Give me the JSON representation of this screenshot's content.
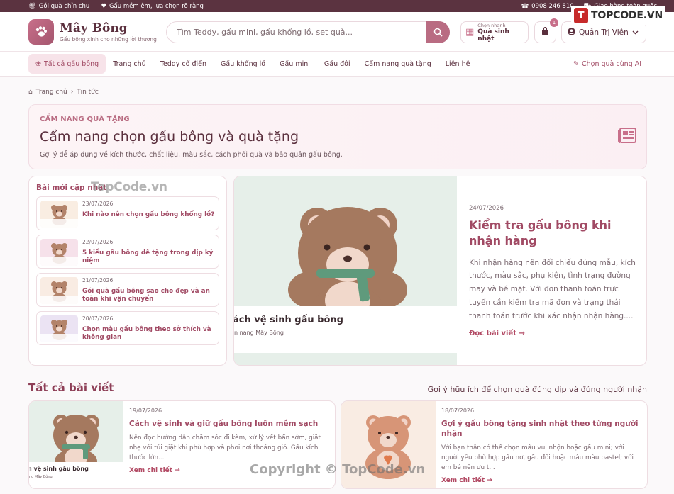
{
  "topbar": {
    "left": [
      "Gói quà chỉn chu",
      "Gấu mềm êm, lựa chọn rõ ràng"
    ],
    "phone": "0908 246 810",
    "shipping": "Giao hàng toàn quốc"
  },
  "brand": {
    "name": "Mây Bông",
    "tagline": "Gấu bông xinh cho những lời thương"
  },
  "watermark_brand": "TOPCODE.VN",
  "search": {
    "placeholder": "Tìm Teddy, gấu mini, gấu khổng lồ, set quà..."
  },
  "quick": {
    "label": "Chọn nhanh",
    "value": "Quà sinh nhật"
  },
  "cart": {
    "count": "1"
  },
  "user": {
    "name": "Quản Trị Viên"
  },
  "nav": {
    "items": [
      "Tất cả gấu bông",
      "Trang chủ",
      "Teddy cổ điển",
      "Gấu khổng lồ",
      "Gấu mini",
      "Gấu đôi",
      "Cẩm nang quà tặng",
      "Liên hệ"
    ],
    "ai": "Chọn quà cùng AI"
  },
  "breadcrumb": {
    "home": "Trang chủ",
    "current": "Tin tức"
  },
  "hero": {
    "kicker": "CẨM NANG QUÀ TẶNG",
    "title": "Cẩm nang chọn gấu bông và quà tặng",
    "subtitle": "Gợi ý dễ áp dụng về kích thước, chất liệu, màu sắc, cách phối quà và bảo quản gấu bông."
  },
  "sidebar": {
    "title": "Bài mới cập nhật",
    "items": [
      {
        "date": "23/07/2026",
        "title": "Khi nào nên chọn gấu bông khổng lồ?",
        "thumb": "#f9ede2"
      },
      {
        "date": "22/07/2026",
        "title": "5 kiểu gấu bông dễ tặng trong dịp kỷ niệm",
        "thumb": "#f6e1ea"
      },
      {
        "date": "21/07/2026",
        "title": "Gói quà gấu bông sao cho đẹp và an toàn khi vận chuyển",
        "thumb": "#f9ece3"
      },
      {
        "date": "20/07/2026",
        "title": "Chọn màu gấu bông theo sở thích và không gian",
        "thumb": "#ebe3f3"
      }
    ]
  },
  "featured": {
    "caption": "ách vệ sinh gấu bông",
    "caption_sub": "n nang Mây Bông",
    "date": "24/07/2026",
    "title": "Kiểm tra gấu bông khi nhận hàng",
    "excerpt": "Khi nhận hàng nên đối chiếu đúng mẫu, kích thước, màu sắc, phụ kiện, tình trạng đường may và bề mặt. Với đơn thanh toán trực tuyến cần kiểm tra mã đơn và trạng thái thanh toán trước khi xác nhận nhận hàng....",
    "more": "Đọc bài viết →"
  },
  "section": {
    "title": "Tất cả bài viết",
    "hint": "Gợi ý hữu ích để chọn quà đúng dịp và đúng người nhận"
  },
  "cards": [
    {
      "date": "19/07/2026",
      "title": "Cách vệ sinh và giữ gấu bông luôn mềm sạch",
      "excerpt": "Nên đọc hướng dẫn chăm sóc đi kèm, xử lý vết bẩn sớm, giặt nhẹ với túi giặt khi phù hợp và phơi nơi thoáng gió. Gấu kích thước lớn...",
      "more": "Xem chi tiết →",
      "caption": "n vệ sinh gấu bông",
      "caption_sub": "ng Mây Bông"
    },
    {
      "date": "18/07/2026",
      "title": "Gợi ý gấu bông tặng sinh nhật theo từng người nhận",
      "excerpt": "Với bạn thân có thể chọn mẫu vui nhộn hoặc gấu mini; với người yêu phù hợp gấu nơ, gấu đôi hoặc mẫu màu pastel; với em bé nên ưu t...",
      "more": "Xem chi tiết →"
    }
  ],
  "watermarks": {
    "site": "TopCode.vn",
    "copyright": "Copyright © TopCode.vn"
  },
  "colors": {
    "primary": "#a14a64",
    "accent": "#c86f8a",
    "topbar": "#5b3340"
  }
}
